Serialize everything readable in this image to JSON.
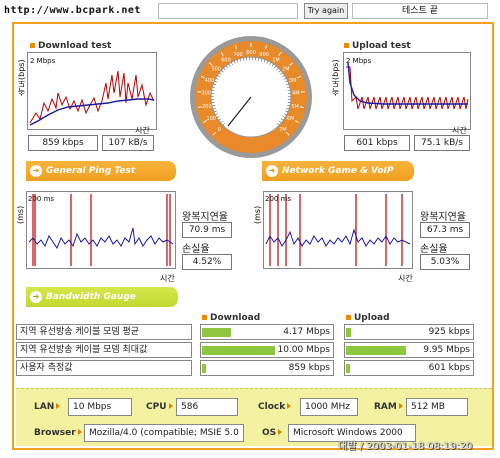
{
  "header": {
    "url_text": "http://www.bcpark.net",
    "try_again": "Try again",
    "test_end": "테스트 끝"
  },
  "download": {
    "title": "Download test",
    "ylabel": "속도(bps)",
    "ymax": "2 Mbps",
    "xlabel": "시간",
    "speed": "859 kbps",
    "rate": "107 kB/s"
  },
  "upload": {
    "title": "Upload test",
    "ylabel": "속도(bps)",
    "ymax": "2 Mbps",
    "xlabel": "시간",
    "speed": "601 kbps",
    "rate": "75.1 kB/s"
  },
  "gauge": {
    "tick_labels": [
      "0",
      "100",
      "200",
      "300",
      "400",
      "500",
      "600",
      "700",
      "800",
      "900",
      "1M",
      "2M",
      "3M",
      "4M",
      "5M",
      "6M",
      "7M"
    ]
  },
  "ping": {
    "tab": "General Ping Test",
    "ylabel": "(ms)",
    "ymax": "200 ms",
    "xlabel": "시간",
    "rtt_label": "왕복지연율",
    "rtt": "70.9 ms",
    "loss_label": "손실율",
    "loss": "4.52%"
  },
  "game": {
    "tab": "Network Game & VoIP Test",
    "ylabel": "(ms)",
    "ymax": "200 ms",
    "xlabel": "시간",
    "rtt_label": "왕복지연율",
    "rtt": "67.3 ms",
    "loss_label": "손실율",
    "loss": "5.03%"
  },
  "bandwidth": {
    "tab": "Bandwidth Gauge",
    "download_header": "Download",
    "upload_header": "Upload",
    "rows": [
      {
        "label": "지역 유선방송 케이블 모뎀 평균",
        "down": "4.17 Mbps",
        "down_frac": 0.22,
        "up": "925 kbps",
        "up_frac": 0.04
      },
      {
        "label": "지역 유선방송 케이블 모뎀 최대값",
        "down": "10.00 Mbps",
        "down_frac": 0.55,
        "up": "9.95 Mbps",
        "up_frac": 0.47
      },
      {
        "label": "사용자 측정값",
        "down": "859 kbps",
        "down_frac": 0.03,
        "up": "601 kbps",
        "up_frac": 0.03
      }
    ]
  },
  "system": {
    "lan_label": "LAN",
    "lan": "10 Mbps",
    "cpu_label": "CPU",
    "cpu": "586",
    "clock_label": "Clock",
    "clock": "1000 MHz",
    "ram_label": "RAM",
    "ram": "512 MB",
    "browser_label": "Browser",
    "browser": "Mozilla/4.0 (compatible; MSIE 5.0",
    "os_label": "OS",
    "os": "Microsoft Windows 2000"
  },
  "watermark": "대발 / 2003-01-18 08:19:20",
  "colors": {
    "accent": "#f3a020",
    "gauge_green": "#8ec63f",
    "panel_yellow": "#f2f2a0",
    "line_blue": "#1a1aa0",
    "spike_red": "#c00000"
  }
}
